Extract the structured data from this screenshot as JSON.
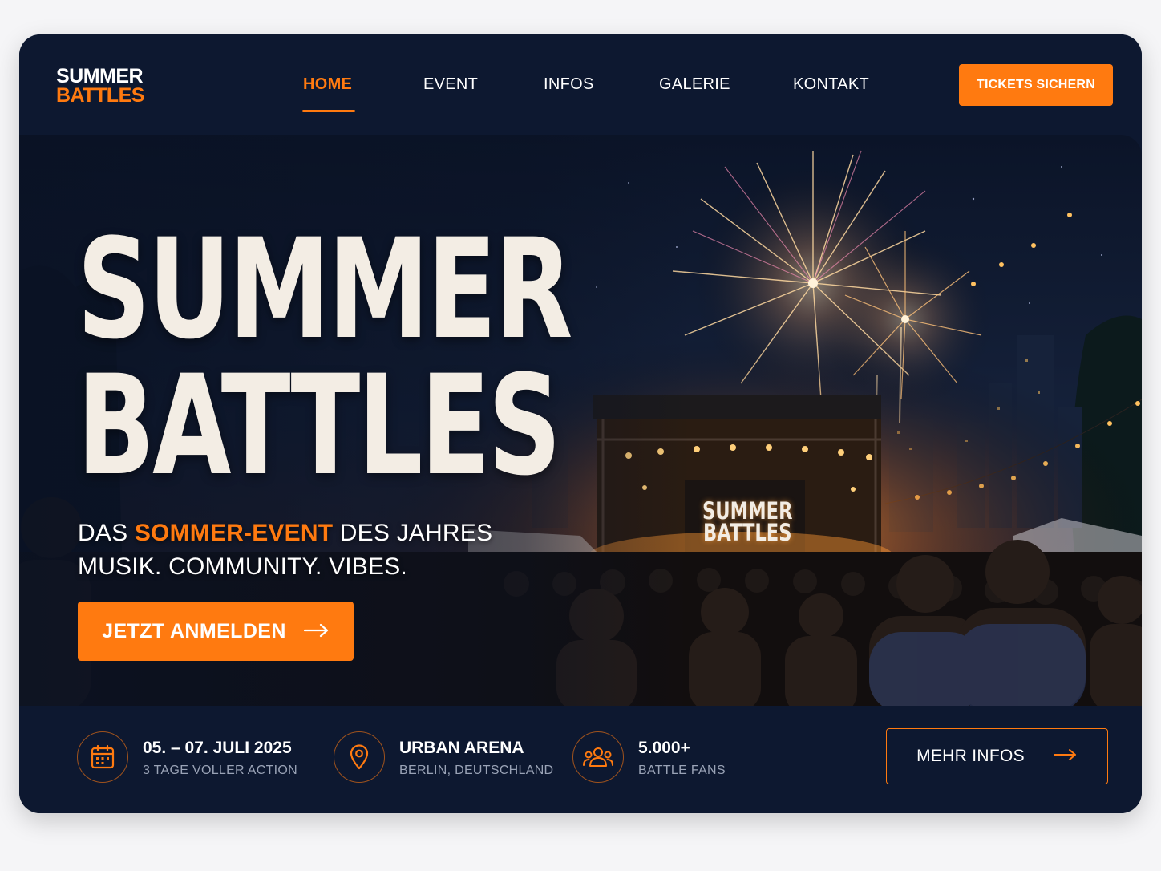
{
  "brand": {
    "line1": "SUMMER",
    "line2": "BATTLES",
    "accent_color": "#ff7a10",
    "bg_color": "#0d1830"
  },
  "nav": {
    "items": [
      {
        "label": "HOME",
        "active": true
      },
      {
        "label": "EVENT",
        "active": false
      },
      {
        "label": "INFOS",
        "active": false
      },
      {
        "label": "GALERIE",
        "active": false
      },
      {
        "label": "KONTAKT",
        "active": false
      }
    ],
    "cta_label": "TICKETS SICHERN"
  },
  "hero": {
    "title_line1": "SUMMER",
    "title_line2": "BATTLES",
    "tagline_pre": "DAS ",
    "tagline_highlight": "SOMMER-EVENT",
    "tagline_post": " DES JAHRES",
    "tagline_line2": "MUSIK. COMMUNITY. VIBES.",
    "cta_label": "JETZT ANMELDEN",
    "cta_icon": "arrow-right-icon",
    "stage_sign_line1": "SUMMER",
    "stage_sign_line2": "BATTLES"
  },
  "info_bar": {
    "items": [
      {
        "icon": "calendar-icon",
        "title": "05. – 07. JULI 2025",
        "subtitle": "3 TAGE VOLLER ACTION"
      },
      {
        "icon": "location-pin-icon",
        "title": "URBAN ARENA",
        "subtitle": "BERLIN, DEUTSCHLAND"
      },
      {
        "icon": "users-group-icon",
        "title": "5.000+",
        "subtitle": "BATTLE FANS"
      }
    ],
    "more_label": "MEHR INFOS",
    "more_icon": "arrow-right-icon"
  }
}
